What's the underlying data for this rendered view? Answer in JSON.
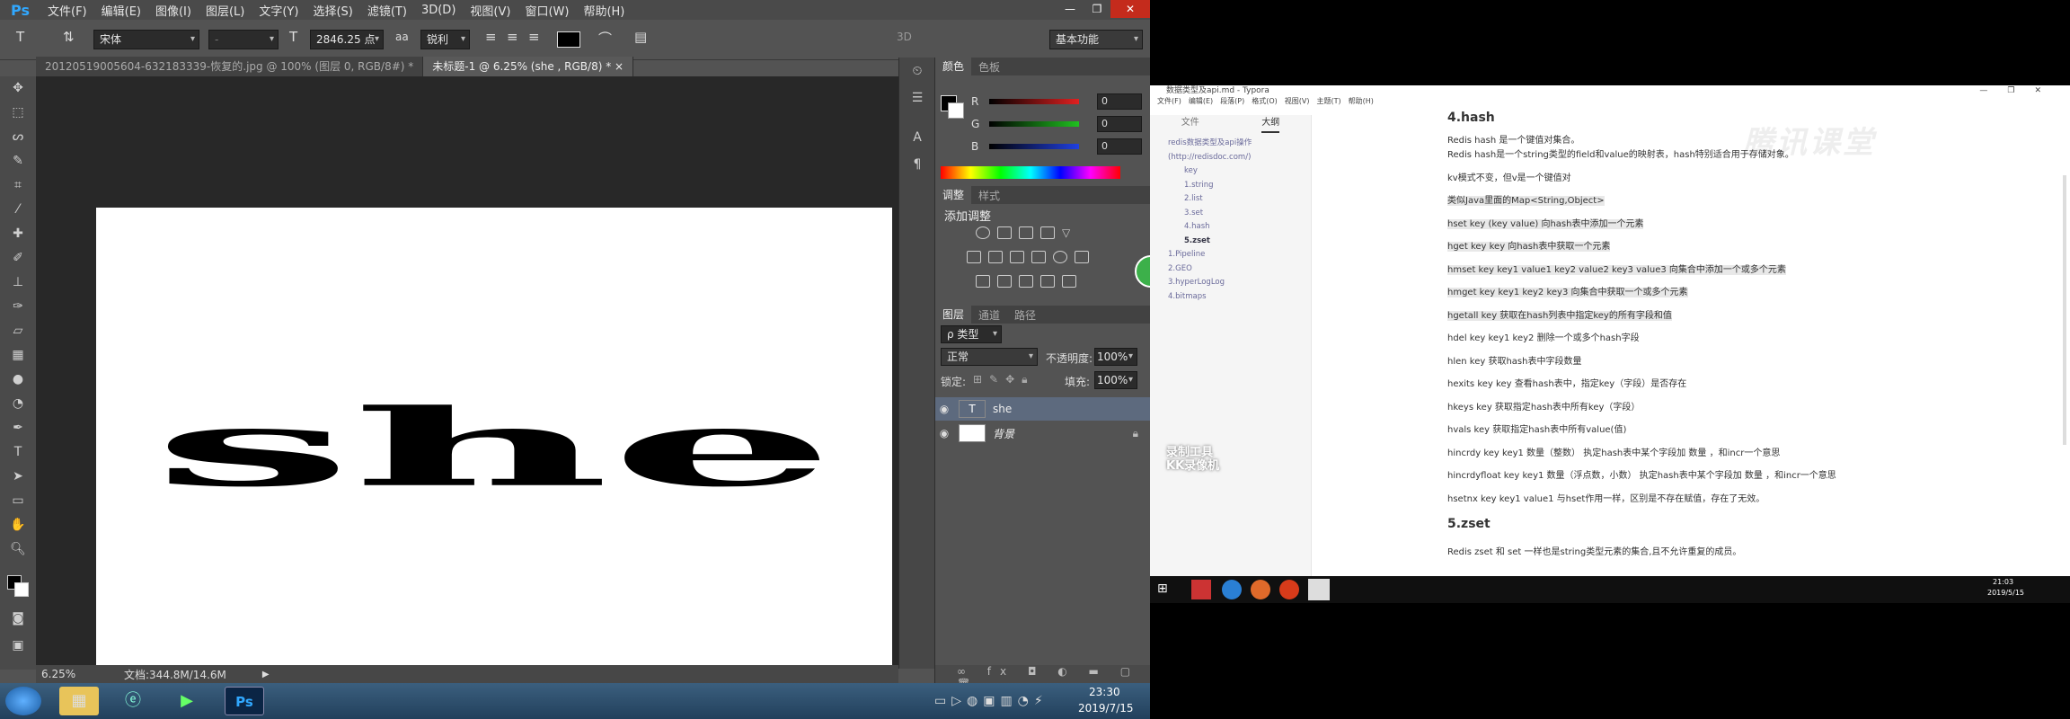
{
  "ps": {
    "logo": "Ps",
    "menu": [
      "文件(F)",
      "编辑(E)",
      "图像(I)",
      "图层(L)",
      "文字(Y)",
      "选择(S)",
      "滤镜(T)",
      "3D(D)",
      "视图(V)",
      "窗口(W)",
      "帮助(H)"
    ],
    "options": {
      "font_family": "宋体",
      "font_style": "-",
      "font_size": "2846.25 点",
      "antialias_label": "aa",
      "antialias": "锐利",
      "threeD": "3D",
      "workspace": "基本功能"
    },
    "tabs": [
      "20120519005604-632183339-恢复的.jpg @ 100% (图层 0, RGB/8#) *",
      "未标题-1 @ 6.25% (she , RGB/8) *"
    ],
    "canvas_text": "she",
    "status": {
      "zoom": "6.25%",
      "doc": "文档:344.8M/14.6M"
    },
    "color_panel": {
      "tabs": [
        "颜色",
        "色板"
      ],
      "channels": [
        {
          "label": "R",
          "value": "0",
          "color": "#e02020"
        },
        {
          "label": "G",
          "value": "0",
          "color": "#20c020"
        },
        {
          "label": "B",
          "value": "0",
          "color": "#2040e0"
        }
      ]
    },
    "adjust_panel": {
      "tabs": [
        "调整",
        "样式"
      ],
      "title": "添加调整"
    },
    "layers_panel": {
      "tabs": [
        "图层",
        "通道",
        "路径"
      ],
      "kind": "ρ 类型",
      "blend": "正常",
      "opacity_label": "不透明度:",
      "opacity": "100%",
      "lock_label": "锁定:",
      "fill_label": "填充:",
      "fill": "100%",
      "layers": [
        {
          "name": "she",
          "type": "T"
        },
        {
          "name": "背景",
          "type": "bg"
        }
      ]
    },
    "taskbar": {
      "time": "23:30",
      "date": "2019/7/15"
    }
  },
  "typora": {
    "title": "数据类型及api.md - Typora",
    "menu": [
      "文件(F)",
      "编辑(E)",
      "段落(P)",
      "格式(O)",
      "视图(V)",
      "主题(T)",
      "帮助(H)"
    ],
    "side_tabs": [
      "文件",
      "大纲"
    ],
    "toc": [
      "redis数据类型及api操作",
      "(http://redisdoc.com/)",
      "key",
      "1.string",
      "2.list",
      "3.set",
      "4.hash",
      "5.zset",
      "1.Pipeline",
      "2.GEO",
      "3.hyperLogLog",
      "4.bitmaps"
    ],
    "content": [
      "4.hash",
      "Redis hash 是一个键值对集合。",
      "Redis hash是一个string类型的field和value的映射表，hash特别适合用于存储对象。",
      "kv模式不变，但v是一个键值对",
      "类似Java里面的Map<String,Object>",
      "hset  key  (key value)  向hash表中添加一个元素",
      "hget key  key  向hash表中获取一个元素",
      "hmset  key key1 value1 key2 value2 key3 value3 向集合中添加一个或多个元素",
      "hmget key  key1 key2 key3  向集合中获取一个或多个元素",
      "hgetall  key    获取在hash列表中指定key的所有字段和值",
      "hdel  key  key1 key2 删除一个或多个hash字段",
      "hlen key 获取hash表中字段数量",
      "hexits key key  查看hash表中，指定key（字段）是否存在",
      "hkeys  key 获取指定hash表中所有key（字段）",
      "hvals key 获取指定hash表中所有value(值)",
      "hincrdy key  key1  数量（整数）  执定hash表中某个字段加  数量  ，和incr一个意思",
      "hincrdyfloat key key1  数量（浮点数，小数）  执定hash表中某个字段加  数量  ，和incr一个意思",
      "hsetnx key key1 value1  与hset作用一样，区别是不存在赋值，存在了无效。",
      "5.zset",
      "Redis zset 和 set 一样也是string类型元素的集合,且不允许重复的成员。"
    ],
    "watermark": "腾讯课堂",
    "badge": "录制工具 KK录像机",
    "win_time": "21:03",
    "win_date": "2019/5/15"
  }
}
